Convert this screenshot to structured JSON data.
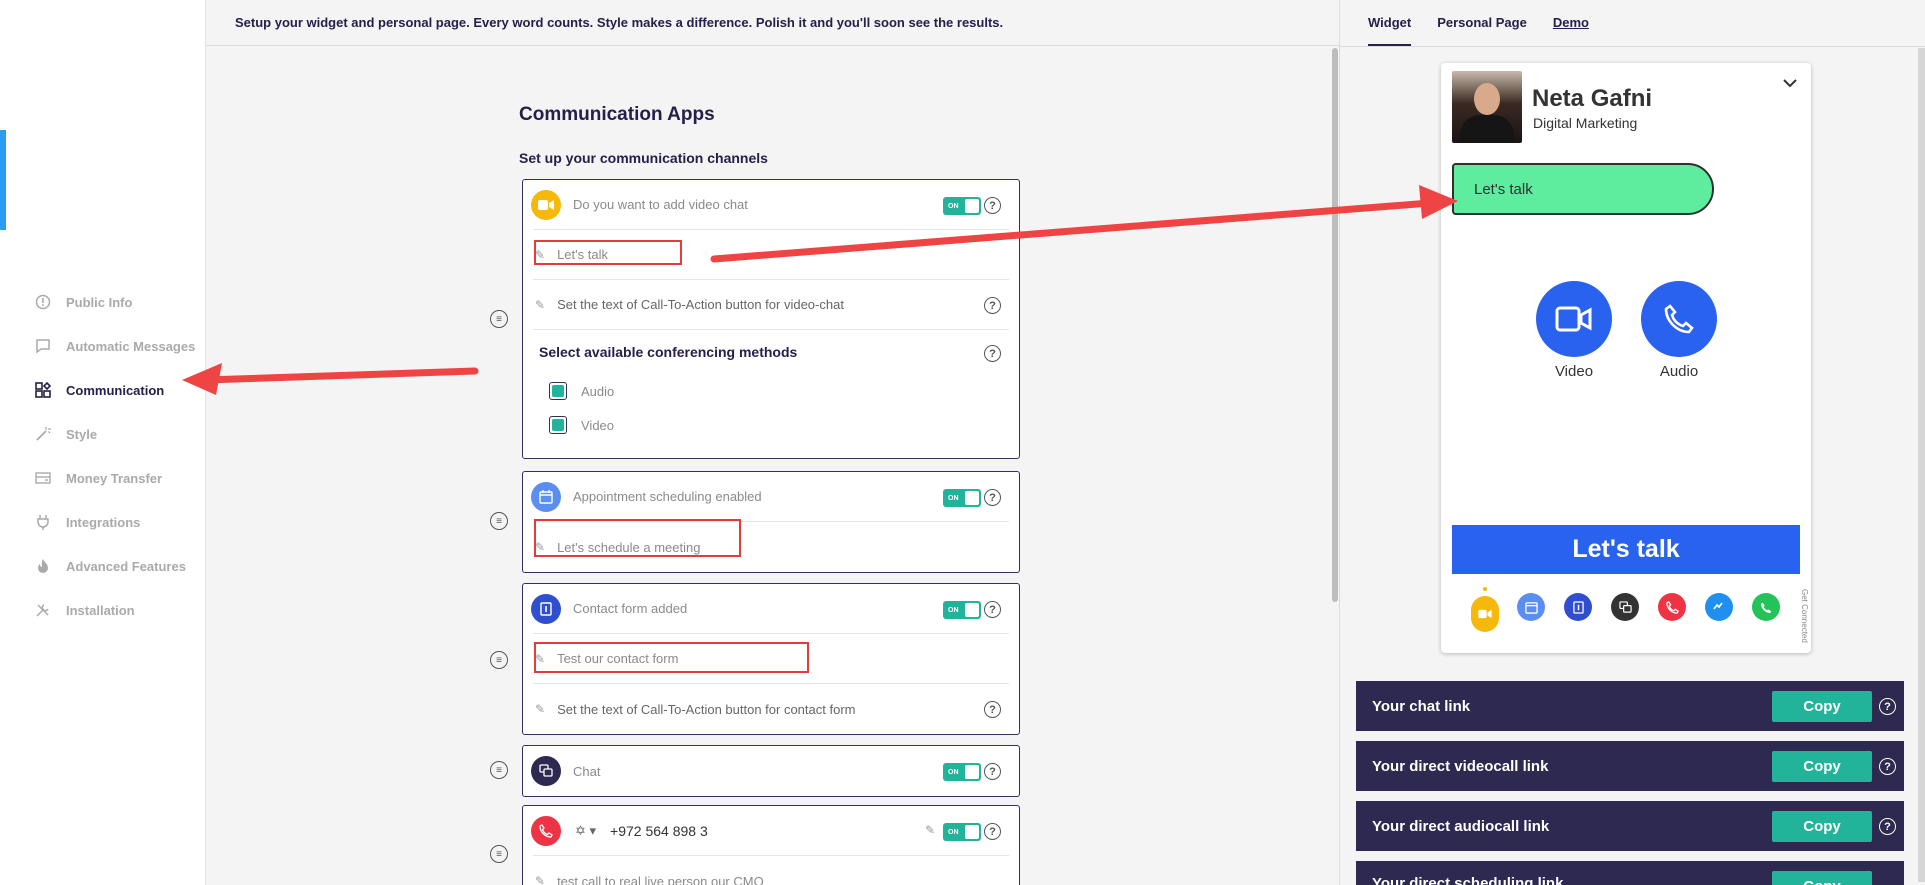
{
  "header": {
    "subtitle": "Setup your widget and personal page. Every word counts. Style makes a difference. Polish it and you'll soon see the results."
  },
  "sidebar": {
    "items": [
      {
        "label": "Public Info",
        "icon": "info-icon",
        "active": false
      },
      {
        "label": "Automatic Messages",
        "icon": "message-icon",
        "active": false
      },
      {
        "label": "Communication",
        "icon": "apps-grid-icon",
        "active": true
      },
      {
        "label": "Style",
        "icon": "magic-wand-icon",
        "active": false
      },
      {
        "label": "Money Transfer",
        "icon": "money-transfer-icon",
        "active": false
      },
      {
        "label": "Integrations",
        "icon": "plug-icon",
        "active": false
      },
      {
        "label": "Advanced Features",
        "icon": "flame-icon",
        "active": false
      },
      {
        "label": "Installation",
        "icon": "tools-icon",
        "active": false
      }
    ]
  },
  "main": {
    "title": "Communication Apps",
    "subtitle": "Set up your communication channels",
    "video": {
      "label": "Do you want to add video chat",
      "toggle": "ON",
      "cta_value": "Let's talk",
      "cta_placeholder": "Set the text of Call-To-Action button for video-chat",
      "conf_title": "Select available conferencing methods",
      "methods": [
        "Audio",
        "Video"
      ]
    },
    "scheduling": {
      "label": "Appointment scheduling enabled",
      "toggle": "ON",
      "cta_value": "Let's schedule a meeting"
    },
    "contact": {
      "label": "Contact form added",
      "toggle": "ON",
      "cta_value": "Test our contact form",
      "cta_placeholder": "Set the text of Call-To-Action button for contact form"
    },
    "chat": {
      "label": "Chat",
      "toggle": "ON"
    },
    "phone": {
      "number": "+972 564 898 3",
      "toggle": "ON",
      "cta_value": "test call to real live person our CMO"
    }
  },
  "preview": {
    "tabs": [
      "Widget",
      "Personal Page",
      "Demo"
    ],
    "name": "Neta Gafni",
    "role": "Digital Marketing",
    "bubble": "Let's talk",
    "video_label": "Video",
    "audio_label": "Audio",
    "main_button": "Let's talk",
    "powered": "Get Connected",
    "links": [
      {
        "label": "Your chat link",
        "button": "Copy"
      },
      {
        "label": "Your direct videocall link",
        "button": "Copy"
      },
      {
        "label": "Your direct audiocall link",
        "button": "Copy"
      },
      {
        "label": "Your direct scheduling link",
        "button": "Copy"
      }
    ]
  },
  "colors": {
    "accent": "#22b39b",
    "primary": "#2a62f0",
    "dark": "#2d2950",
    "bubble": "#5eed9e",
    "annotation": "#e23b3b"
  }
}
